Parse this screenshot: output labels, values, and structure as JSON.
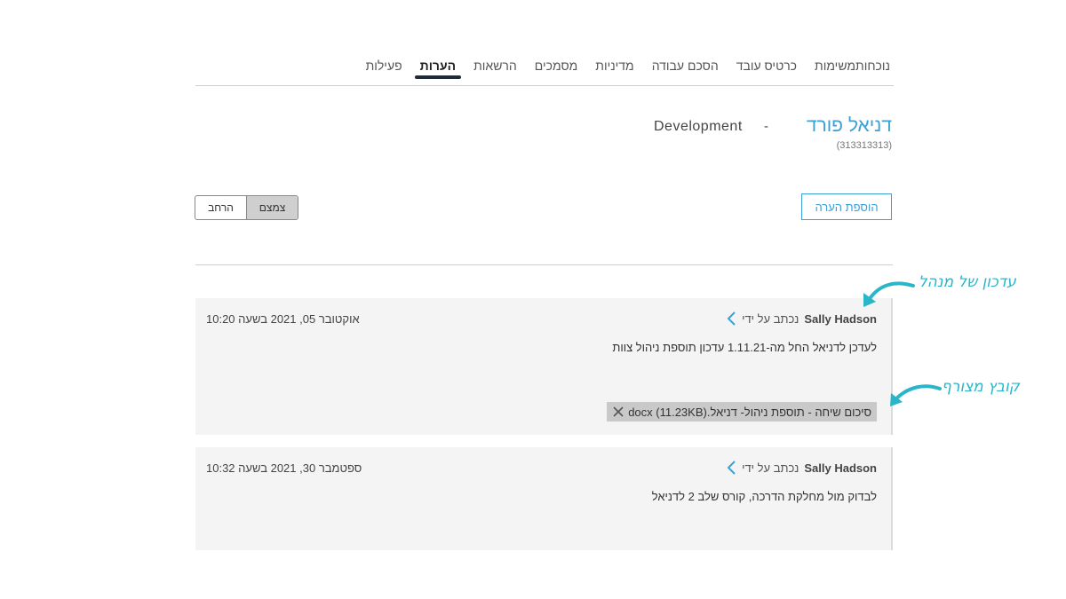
{
  "tabs": [
    {
      "label": "נוכחות"
    },
    {
      "label": "משימות"
    },
    {
      "label": "כרטיס עובד"
    },
    {
      "label": "הסכם עבודה"
    },
    {
      "label": "מדיניות"
    },
    {
      "label": "מסמכים"
    },
    {
      "label": "הרשאות"
    },
    {
      "label": "הערות",
      "active": true
    },
    {
      "label": "פעילות"
    }
  ],
  "employee": {
    "name": "דניאל פורד",
    "id": "(313313313)",
    "separator": "-",
    "department": "Development"
  },
  "actions": {
    "add_note": "הוספת הערה",
    "compact": "צמצם",
    "expand": "הרחב"
  },
  "notes": [
    {
      "written_by": "נכתב על ידי",
      "author": "Sally Hadson",
      "date": "אוקטובר 05, 2021 בשעה 10:20",
      "body": "לעדכן לדניאל החל מה-1.11.21 עדכון תוספת ניהול צוות",
      "attachment": "סיכום שיחה - תוספת ניהול- דניאל.docx (11.23KB)"
    },
    {
      "written_by": "נכתב על ידי",
      "author": "Sally Hadson",
      "date": "ספטמבר 30, 2021 בשעה 10:32",
      "body": "לבדוק מול מחלקת הדרכה, קורס שלב 2 לדניאל"
    }
  ],
  "annotations": {
    "manager_update": "עדכון של מנהל",
    "attached_file": "קובץ מצורף"
  },
  "colors": {
    "accent": "#3aa0d5",
    "annotation": "#2bb5c8",
    "active_tab_bar": "#1f2a3a"
  }
}
